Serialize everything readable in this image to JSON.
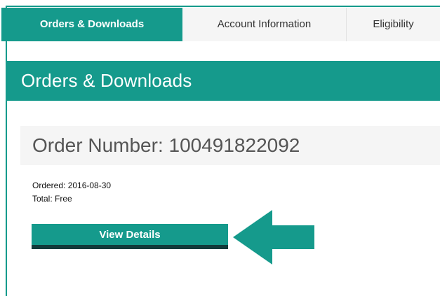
{
  "tabs": [
    {
      "label": "Orders & Downloads",
      "active": true
    },
    {
      "label": "Account Information",
      "active": false
    },
    {
      "label": "Eligibility",
      "active": false
    }
  ],
  "header": {
    "title": "Orders & Downloads"
  },
  "order": {
    "title": "Order Number: 100491822092",
    "ordered": "Ordered: 2016-08-30",
    "total": "Total: Free",
    "view_details_label": "View Details"
  },
  "colors": {
    "accent": "#159a8c",
    "button_shadow": "#123a3a",
    "panel_bg": "#f5f5f5"
  },
  "icons": {
    "annotation": "left-arrow-icon"
  }
}
